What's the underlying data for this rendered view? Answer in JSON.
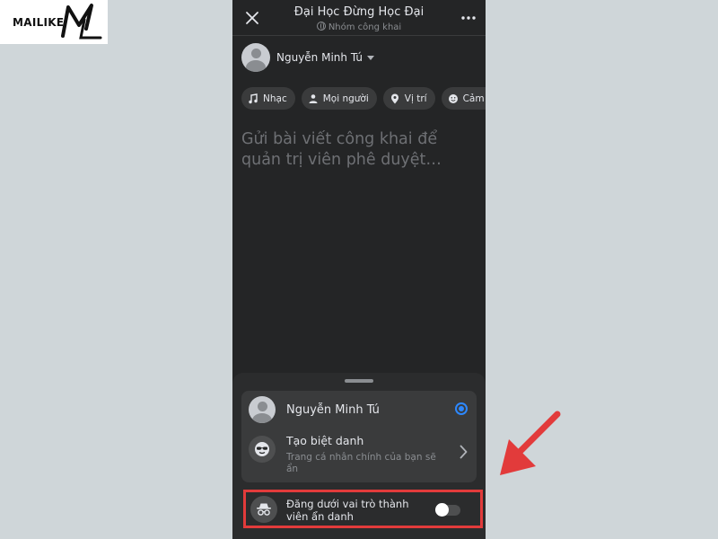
{
  "brand": {
    "logo_text": "MAILIKE",
    "logo_mark": "ML"
  },
  "header": {
    "title": "Đại Học Đừng Học Đại",
    "subtitle": "Nhóm công khai",
    "close_icon": "close-icon",
    "more_icon": "more-horizontal-icon"
  },
  "author": {
    "name": "Nguyễn Minh Tú"
  },
  "chips": [
    {
      "label": "Nhạc",
      "icon": "music-note-icon"
    },
    {
      "label": "Mọi người",
      "icon": "people-icon"
    },
    {
      "label": "Vị trí",
      "icon": "location-pin-icon"
    },
    {
      "label": "Cảm xú",
      "icon": "smiley-icon"
    }
  ],
  "composer": {
    "placeholder": "Gửi bài viết công khai để quản trị viên phê duyệt…"
  },
  "sheet": {
    "identity_name": "Nguyễn Minh Tú",
    "nickname_title": "Tạo biệt danh",
    "nickname_subtitle": "Trang cá nhân chính của bạn sẽ ẩn",
    "anonymous_label": "Đăng dưới vai trò thành viên ẩn danh",
    "anonymous_enabled": false,
    "selected_color": "#2d88ff"
  },
  "annotation": {
    "highlight_color": "#e23b3b"
  }
}
